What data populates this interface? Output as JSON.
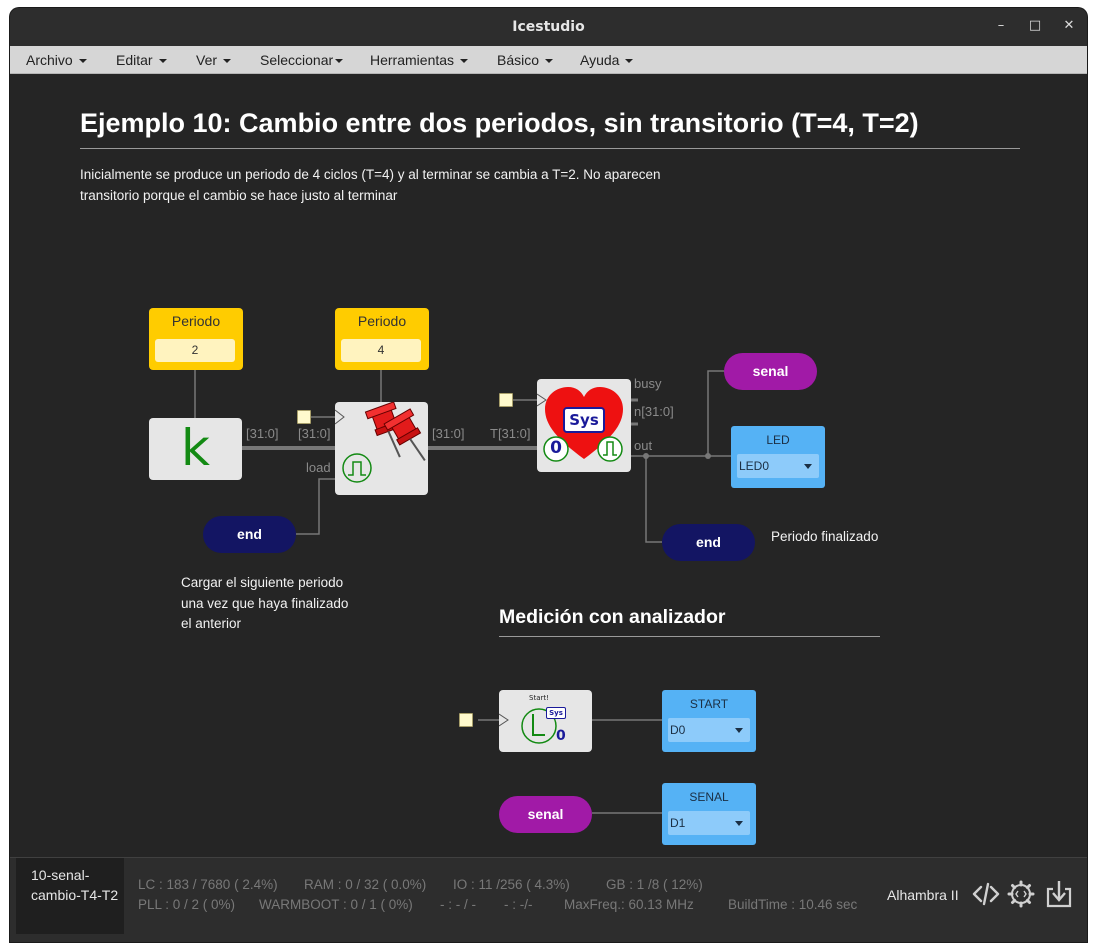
{
  "window": {
    "title": "Icestudio",
    "controls": [
      "minimize",
      "maximize",
      "close"
    ]
  },
  "menu": [
    "Archivo",
    "Editar",
    "Ver",
    "Seleccionar",
    "Herramientas",
    "Básico",
    "Ayuda"
  ],
  "canvas": {
    "title": "Ejemplo 10: Cambio entre dos periodos, sin transitorio (T=4, T=2)",
    "description": "Inicialmente se produce un periodo de 4 ciclos (T=4) y al terminar se cambia a T=2. No aparecen transitorio porque el cambio se hace justo al terminar",
    "constants": [
      {
        "label": "Periodo",
        "value": "2"
      },
      {
        "label": "Periodo",
        "value": "4"
      }
    ],
    "k_block": {
      "symbol": "k"
    },
    "ports": {
      "k_out": "[31:0]",
      "reg_in": "[31:0]",
      "reg_load": "load",
      "reg_out": "[31:0]",
      "timer_in": "T[31:0]",
      "timer_busy": "busy",
      "timer_n": "n[31:0]",
      "timer_out": "out"
    },
    "sys_block": {
      "label": "Sys",
      "zero": "0"
    },
    "labels": {
      "senal": "senal",
      "end": "end",
      "end2": "end",
      "senal2": "senal"
    },
    "pins": [
      {
        "label": "LED",
        "value": "LED0"
      },
      {
        "label": "START",
        "value": "D0"
      },
      {
        "label": "SENAL",
        "value": "D1"
      }
    ],
    "notes": {
      "load_note": "Cargar el siguiente periodo una vez que haya finalizado el anterior",
      "end_note": "Periodo finalizado"
    },
    "section_title": "Medición con analizador",
    "start_block": {
      "title": "Start!",
      "sys": "Sys",
      "zero": "0"
    }
  },
  "footer": {
    "file": "10-senal-cambio-T4-T2",
    "stats_row1": [
      "LC : 183 / 7680 ( 2.4%)",
      "RAM : 0 / 32 ( 0.0%)",
      "IO : 11 /256 ( 4.3%)",
      "GB : 1 /8 ( 12%)"
    ],
    "stats_row2": [
      "PLL : 0 / 2 ( 0%)",
      "WARMBOOT : 0 / 1 ( 0%)",
      "- : - / -",
      "- : -/-",
      "MaxFreq.: 60.13 MHz",
      "BuildTime : 10.46 sec"
    ],
    "board": "Alhambra II"
  },
  "colors": {
    "canvas": "#252525",
    "constant": "#ffcc00",
    "pin": "#55b2f5",
    "label_magenta": "#a11aa7",
    "label_navy": "#131563",
    "wire": "#777777"
  }
}
